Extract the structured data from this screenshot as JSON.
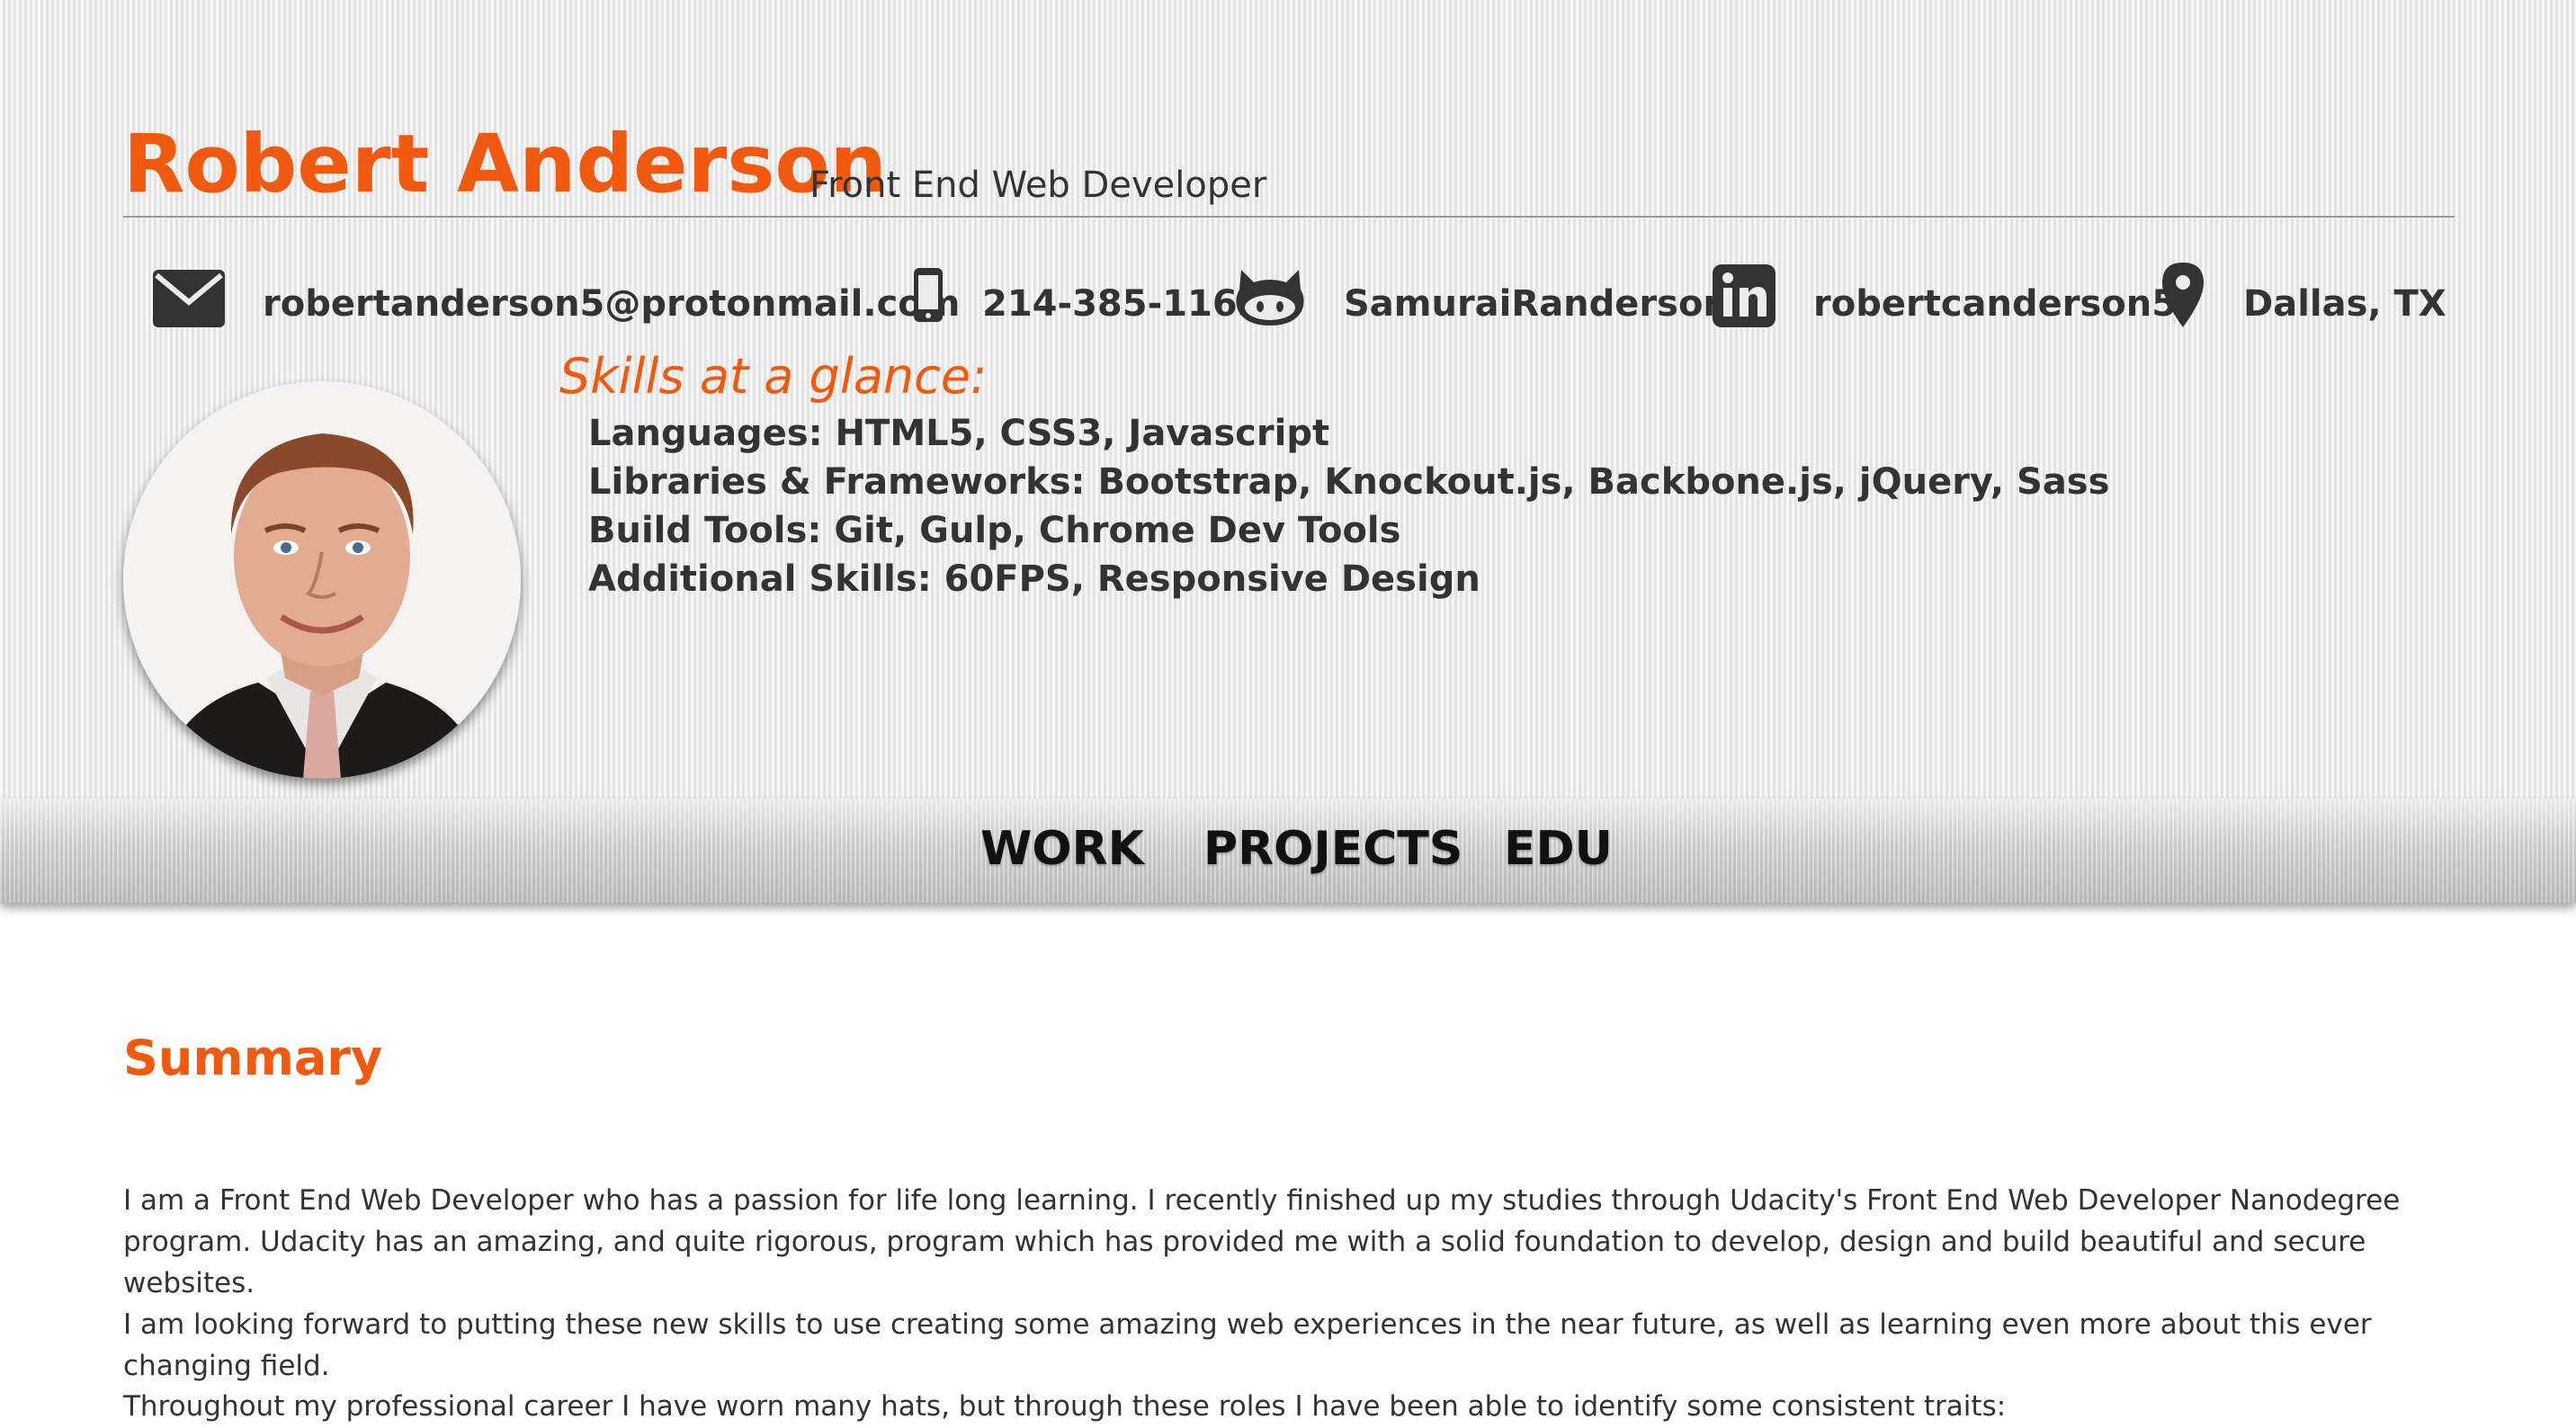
{
  "header": {
    "name": "Robert Anderson",
    "role": "Front End Web Developer"
  },
  "contacts": {
    "email": {
      "icon": "envelope-icon",
      "value": "robertanderson5@protonmail.com"
    },
    "mobile": {
      "icon": "mobile-phone-icon",
      "value": "214-385-1163"
    },
    "github": {
      "icon": "github-icon",
      "value": "SamuraiRanderson"
    },
    "linkedin": {
      "icon": "linkedin-icon",
      "value": "robertcanderson5"
    },
    "location": {
      "icon": "map-pin-icon",
      "value": "Dallas, TX"
    }
  },
  "skills": {
    "title": "Skills at a glance:",
    "lines": [
      "Languages: HTML5, CSS3, Javascript",
      "Libraries & Frameworks: Bootstrap, Knockout.js, Backbone.js, jQuery, Sass",
      "Build Tools: Git, Gulp, Chrome Dev Tools",
      "Additional Skills: 60FPS, Responsive Design"
    ]
  },
  "nav": {
    "items": [
      "WORK",
      "PROJECTS",
      "EDU"
    ]
  },
  "summary": {
    "title": "Summary",
    "paragraphs": [
      "I am a Front End Web Developer who has a passion for life long learning. I recently finished up my studies through Udacity's Front End Web Developer Nanodegree program. Udacity has an amazing, and quite rigorous, program which has provided me with a solid foundation to develop, design and build beautiful and secure websites.",
      "I am looking forward to putting these new skills to use creating some amazing web experiences in the near future, as well as learning even more about this ever changing field.",
      "Throughout my professional career I have worn many hats, but through these roles I have been able to identify some consistent traits:"
    ]
  },
  "colors": {
    "accent": "#f15a0e",
    "text": "#333333",
    "header_bg": "#ececec",
    "nav_bg": "#d6d6d6"
  }
}
